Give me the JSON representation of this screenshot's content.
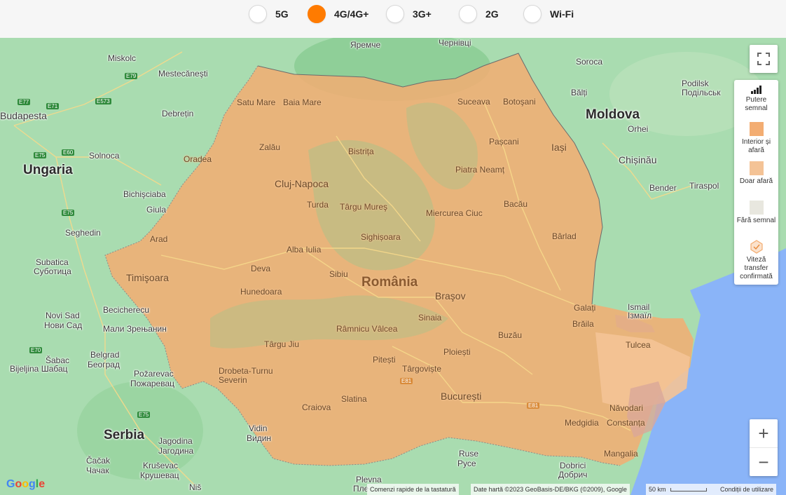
{
  "tech_options": [
    {
      "label": "5G",
      "selected": false
    },
    {
      "label": "4G/4G+",
      "selected": true
    },
    {
      "label": "3G+",
      "selected": false
    },
    {
      "label": "2G",
      "selected": false
    },
    {
      "label": "Wi-Fi",
      "selected": false
    }
  ],
  "colors": {
    "accent": "#ff7b00",
    "coverage_indoor": "#f3ad72",
    "coverage_outdoor": "#f4c396",
    "no_signal": "#e8e7df"
  },
  "map": {
    "country_labels": {
      "hungary": "Ungaria",
      "moldova": "Moldova",
      "serbia": "Serbia",
      "romania": "România"
    },
    "places": {
      "budapest": "Budapesta",
      "miskolc": "Miskolc",
      "mestecanesti": "Mestecăneşti",
      "debretin": "Debrețin",
      "solnoca": "Solnoca",
      "bichisciaba": "Bichişciaba",
      "giula": "Giula",
      "seghedin": "Seghedin",
      "subatica": "Subatica",
      "subatica_cyr": "Суботица",
      "novi_sad": "Novi Sad",
      "novi_sad_cyr": "Нови Сад",
      "beciche": "Becicherecu",
      "zrenjanin_cyr": "Мали Зрењанин",
      "belgrad": "Belgrad",
      "belgrad_cyr": "Београд",
      "sabac": "Šabac",
      "bijeljina": "Bijeljina Шабац",
      "pozarevac": "Požarevac",
      "pozarevac_cyr": "Пожаревац",
      "jagodina": "Jagodina",
      "jagodina_cyr": "Јагодина",
      "cacak": "Čačak",
      "cacak_cyr": "Чачак",
      "krusevac": "Kruševac",
      "krusevac_cyr": "Крушевац",
      "nis": "Niš",
      "yaremche": "Яремче",
      "chernivtsi": "Чернівці",
      "soroca": "Soroca",
      "balti": "Bălți",
      "orhei": "Orhei",
      "chisinau": "Chișinău",
      "bender": "Bender",
      "tiraspol": "Tiraspol",
      "ismail": "Ismail",
      "ismail_cyr": "Ізмаїл",
      "podilsk": "Подільськ",
      "podilsk_lat": "Podilsk",
      "pleven": "Plevna",
      "pleven_cyr": "Пле",
      "ruse": "Ruse",
      "ruse_cyr": "Русе",
      "dobrich": "Dobrici",
      "dobrich_cyr": "Добрич",
      "vidin": "Vidin",
      "vidin_cyr": "Видин"
    },
    "ro_places": {
      "satu_mare": "Satu Mare",
      "baia_mare": "Baia Mare",
      "suceava": "Suceava",
      "botosani": "Botoşani",
      "zalau": "Zalău",
      "bistrita": "Bistrița",
      "pascani": "Pașcani",
      "iasi": "Iași",
      "oradea": "Oradea",
      "cluj": "Cluj-Napoca",
      "piatra": "Piatra Neamț",
      "turda": "Turda",
      "targu_mures": "Târgu Mureş",
      "bacau": "Bacău",
      "miercurea": "Miercurea Ciuc",
      "arad": "Arad",
      "sighisoara": "Sighișoara",
      "barlad": "Bârlad",
      "alba": "Alba Iulia",
      "timisoara": "Timişoara",
      "deva": "Deva",
      "sibiu": "Sibiu",
      "hunedoara": "Hunedoara",
      "brasov": "Braşov",
      "galati": "Galați",
      "braila": "Brăila",
      "sinaia": "Sinaia",
      "ramnicu": "Râmnicu Vâlcea",
      "buzau": "Buzău",
      "targu_jiu": "Târgu Jiu",
      "tulcea": "Tulcea",
      "ploiesti": "Ploiești",
      "pitesti": "Pitești",
      "targoviste": "Târgoviște",
      "drobeta": "Drobeta-Turnu Severin",
      "slatina": "Slatina",
      "bucuresti": "București",
      "craiova": "Craiova",
      "navodari": "Năvodari",
      "medgidia": "Medgidia",
      "constanta": "Constanța",
      "mangalia": "Mangalia"
    },
    "roads": [
      "E77",
      "E79",
      "E71",
      "E573",
      "E75",
      "E60",
      "E75",
      "E70",
      "E75",
      "E81",
      "E81"
    ]
  },
  "legend": {
    "title": "Putere semnal",
    "items": [
      {
        "label": "Interior și afară",
        "color": "#f3ad72"
      },
      {
        "label": "Doar afară",
        "color": "#f4c396"
      },
      {
        "label": "Fără semnal",
        "color": "#e8e7df"
      },
      {
        "label": "Viteză transfer confirmată",
        "color": "#ffffff"
      }
    ]
  },
  "controls": {
    "zoom_in": "+",
    "zoom_out": "−"
  },
  "attribution": {
    "google": "Google",
    "shortcuts": "Comenzi rapide de la tastatură",
    "data": "Date hartă ©2023 GeoBasis-DE/BKG (©2009), Google",
    "scale": "50 km",
    "terms": "Condiții de utilizare"
  }
}
